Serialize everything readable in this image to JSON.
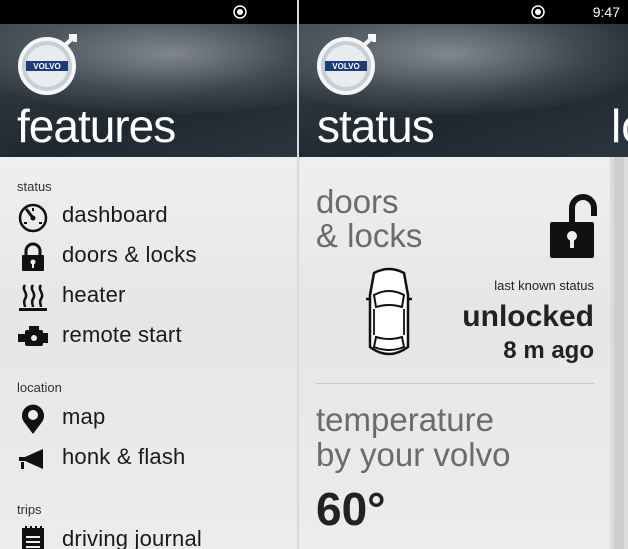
{
  "statusbar": {
    "time": "9:47"
  },
  "brand": {
    "logo_text": "VOLVO"
  },
  "left_screen": {
    "title": "features",
    "sections": [
      {
        "label": "status",
        "items": [
          {
            "label": "dashboard",
            "icon": "speedometer-icon"
          },
          {
            "label": "doors & locks",
            "icon": "lock-icon"
          },
          {
            "label": "heater",
            "icon": "heater-icon"
          },
          {
            "label": "remote start",
            "icon": "engine-icon"
          }
        ]
      },
      {
        "label": "location",
        "items": [
          {
            "label": "map",
            "icon": "map-pin-icon"
          },
          {
            "label": "honk & flash",
            "icon": "horn-icon"
          }
        ]
      },
      {
        "label": "trips",
        "items": [
          {
            "label": "driving journal",
            "icon": "journal-icon"
          }
        ]
      }
    ]
  },
  "right_screen": {
    "title": "status",
    "next_title_peek": "lo",
    "doors": {
      "heading_line1": "doors",
      "heading_line2": "& locks",
      "status_label": "last known status",
      "status_value": "unlocked",
      "time_ago": "8 m ago"
    },
    "temperature": {
      "heading_line1": "temperature",
      "heading_line2": "by your volvo",
      "value": "60°"
    }
  },
  "colors": {
    "header_dark": "#2a323b",
    "background": "#ececec",
    "text_dark": "#1a1a1a",
    "heading_gray": "#6b6b6b"
  }
}
